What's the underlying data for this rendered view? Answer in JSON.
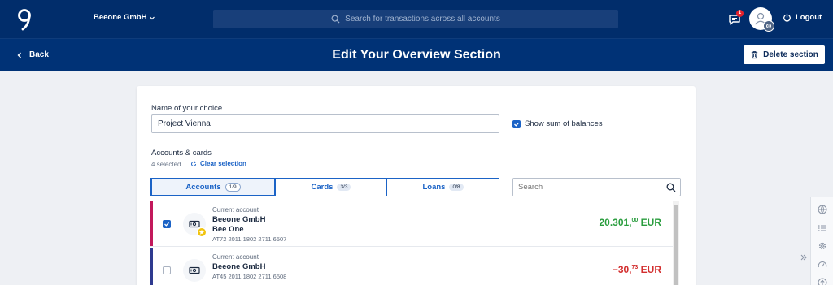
{
  "topbar": {
    "company": "Beeone GmbH",
    "search_placeholder": "Search for transactions across all accounts",
    "messages_badge": "1",
    "logout_label": "Logout"
  },
  "subbar": {
    "back_label": "Back",
    "title": "Edit Your Overview Section",
    "delete_label": "Delete section"
  },
  "form": {
    "name_label": "Name of your choice",
    "name_value": "Project Vienna",
    "show_sum_label": "Show sum of balances",
    "show_sum_checked": true,
    "accounts_label": "Accounts & cards",
    "selected_text": "4 selected",
    "clear_label": "Clear selection"
  },
  "tabs": [
    {
      "label": "Accounts",
      "count": "1/9",
      "active": true
    },
    {
      "label": "Cards",
      "count": "3/3",
      "active": false
    },
    {
      "label": "Loans",
      "count": "0/8",
      "active": false
    }
  ],
  "account_search": {
    "placeholder": "Search"
  },
  "accounts": [
    {
      "type": "Current account",
      "name": "Beeone GmbH",
      "subname": "Bee One",
      "iban": "AT72 2011 1802 2711 6507",
      "amount_main": "20.301,",
      "amount_cents": "00",
      "currency": "EUR",
      "checked": true,
      "favorite": true,
      "bar_color": "#c2185b",
      "amount_color": "#2a9d3e"
    },
    {
      "type": "Current account",
      "name": "Beeone GmbH",
      "iban": "AT45 2011 1802 2711 6508",
      "amount_main": "−30,",
      "amount_cents": "73",
      "currency": "EUR",
      "checked": false,
      "favorite": false,
      "bar_color": "#2f3a8f",
      "amount_color": "#d32f2f"
    }
  ],
  "colors": {
    "header_bg": "#012d6b",
    "subheader_bg": "#003276",
    "accent": "#1b63c6"
  },
  "icons": [
    "logo-icon",
    "chevron-down-icon",
    "search-icon",
    "message-icon",
    "user-icon",
    "gear-icon",
    "power-icon",
    "back-arrow-icon",
    "trash-icon",
    "refresh-icon",
    "checkmark-icon",
    "account-icon",
    "star-icon",
    "globe-icon",
    "list-icon",
    "settings-icon",
    "gauge-icon",
    "arrow-up-icon",
    "double-chevron-icon"
  ]
}
